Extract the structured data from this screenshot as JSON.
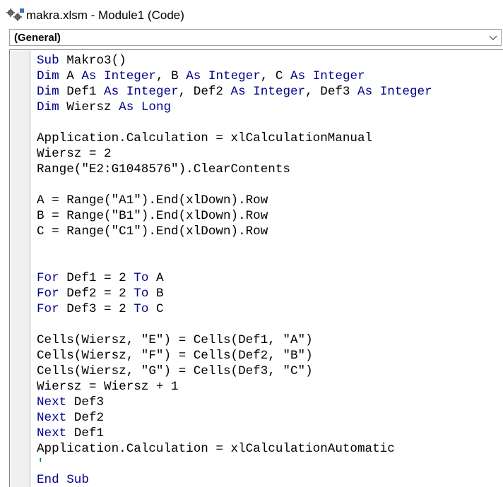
{
  "window": {
    "title": "makra.xlsm - Module1 (Code)",
    "icon": "vba-module-icon"
  },
  "object_dropdown": {
    "selected": "(General)"
  },
  "code": {
    "lines": [
      [
        {
          "t": "Sub",
          "k": true
        },
        {
          "t": " Makro3()"
        }
      ],
      [
        {
          "t": "Dim",
          "k": true
        },
        {
          "t": " A "
        },
        {
          "t": "As",
          "k": true
        },
        {
          "t": " "
        },
        {
          "t": "Integer",
          "k": true
        },
        {
          "t": ", B "
        },
        {
          "t": "As",
          "k": true
        },
        {
          "t": " "
        },
        {
          "t": "Integer",
          "k": true
        },
        {
          "t": ", C "
        },
        {
          "t": "As",
          "k": true
        },
        {
          "t": " "
        },
        {
          "t": "Integer",
          "k": true
        }
      ],
      [
        {
          "t": "Dim",
          "k": true
        },
        {
          "t": " Def1 "
        },
        {
          "t": "As",
          "k": true
        },
        {
          "t": " "
        },
        {
          "t": "Integer",
          "k": true
        },
        {
          "t": ", Def2 "
        },
        {
          "t": "As",
          "k": true
        },
        {
          "t": " "
        },
        {
          "t": "Integer",
          "k": true
        },
        {
          "t": ", Def3 "
        },
        {
          "t": "As",
          "k": true
        },
        {
          "t": " "
        },
        {
          "t": "Integer",
          "k": true
        }
      ],
      [
        {
          "t": "Dim",
          "k": true
        },
        {
          "t": " Wiersz "
        },
        {
          "t": "As",
          "k": true
        },
        {
          "t": " "
        },
        {
          "t": "Long",
          "k": true
        }
      ],
      [],
      [
        {
          "t": "Application.Calculation = xlCalculationManual"
        }
      ],
      [
        {
          "t": "Wiersz = 2"
        }
      ],
      [
        {
          "t": "Range(\"E2:G1048576\").ClearContents"
        }
      ],
      [],
      [
        {
          "t": "A = Range(\"A1\").End(xlDown).Row"
        }
      ],
      [
        {
          "t": "B = Range(\"B1\").End(xlDown).Row"
        }
      ],
      [
        {
          "t": "C = Range(\"C1\").End(xlDown).Row"
        }
      ],
      [],
      [],
      [
        {
          "t": "For",
          "k": true
        },
        {
          "t": " Def1 = 2 "
        },
        {
          "t": "To",
          "k": true
        },
        {
          "t": " A"
        }
      ],
      [
        {
          "t": "For",
          "k": true
        },
        {
          "t": " Def2 = 2 "
        },
        {
          "t": "To",
          "k": true
        },
        {
          "t": " B"
        }
      ],
      [
        {
          "t": "For",
          "k": true
        },
        {
          "t": " Def3 = 2 "
        },
        {
          "t": "To",
          "k": true
        },
        {
          "t": " C"
        }
      ],
      [],
      [
        {
          "t": "Cells(Wiersz, \"E\") = Cells(Def1, \"A\")"
        }
      ],
      [
        {
          "t": "Cells(Wiersz, \"F\") = Cells(Def2, \"B\")"
        }
      ],
      [
        {
          "t": "Cells(Wiersz, \"G\") = Cells(Def3, \"C\")"
        }
      ],
      [
        {
          "t": "Wiersz = Wiersz + 1"
        }
      ],
      [
        {
          "t": "Next",
          "k": true
        },
        {
          "t": " Def3"
        }
      ],
      [
        {
          "t": "Next",
          "k": true
        },
        {
          "t": " Def2"
        }
      ],
      [
        {
          "t": "Next",
          "k": true
        },
        {
          "t": " Def1"
        }
      ],
      [
        {
          "t": "Application.Calculation = xlCalculationAutomatic"
        }
      ],
      [
        {
          "t": "'",
          "c": true
        }
      ],
      [
        {
          "t": "End Sub",
          "k": true
        }
      ]
    ]
  },
  "colors": {
    "keyword": "#00008b",
    "comment": "#008000",
    "text": "#000000"
  }
}
